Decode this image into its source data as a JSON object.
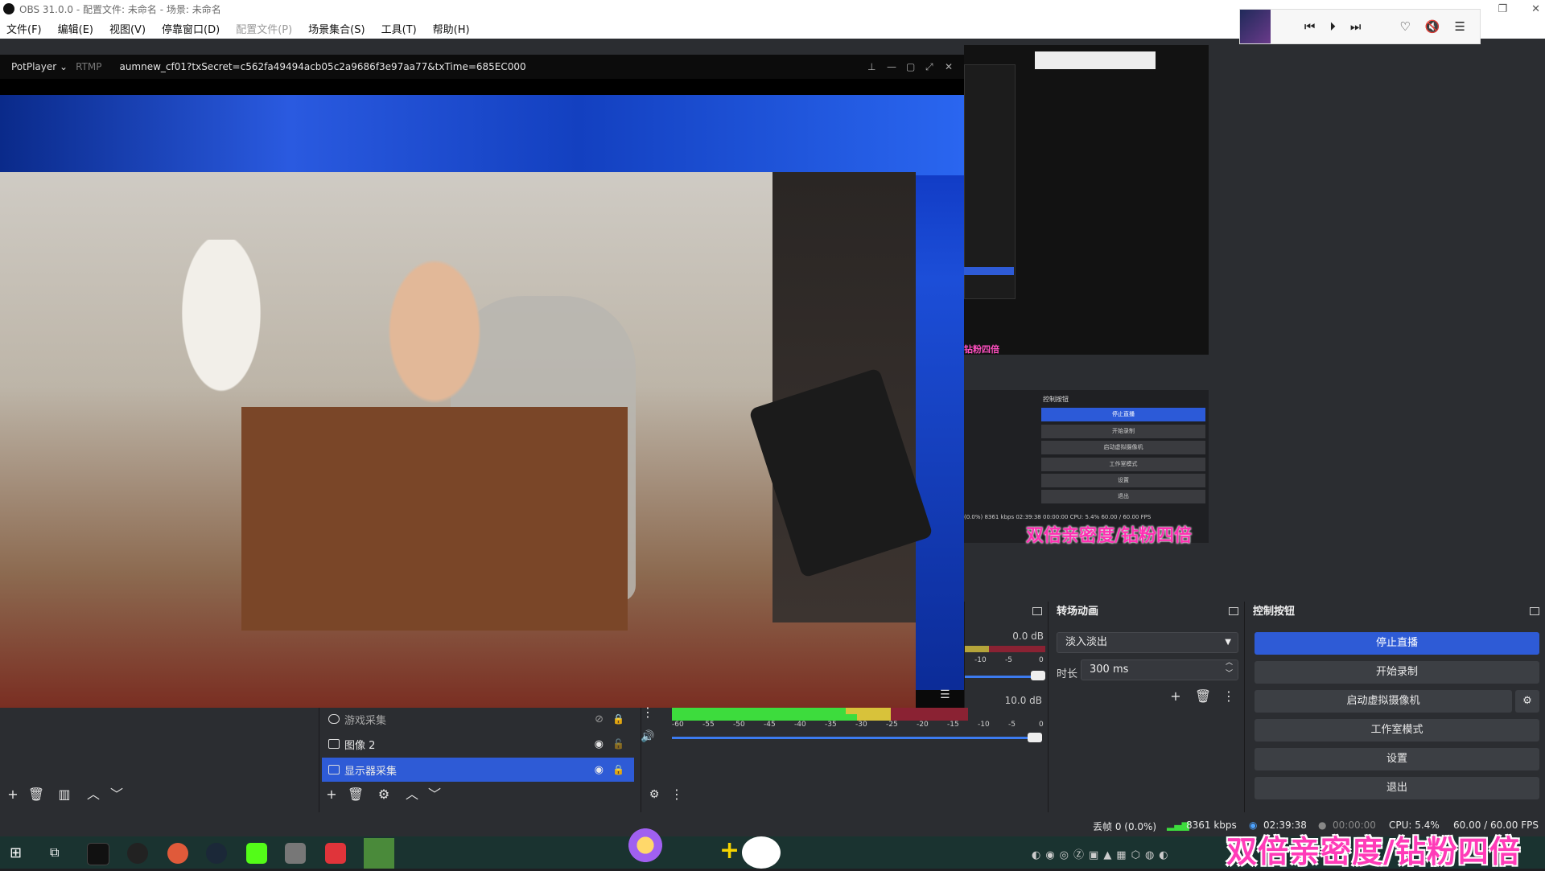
{
  "window": {
    "title": "OBS 31.0.0 - 配置文件: 未命名 - 场景: 未命名",
    "min": "—",
    "max": "❐",
    "close": "✕"
  },
  "menu": [
    "文件(F)",
    "编辑(E)",
    "视图(V)",
    "停靠窗口(D)",
    "配置文件(P)",
    "场景集合(S)",
    "工具(T)",
    "帮助(H)"
  ],
  "potplayer": {
    "app": "PotPlayer",
    "protocol": "RTMP",
    "url": "aumnew_cf01?txSecret=c562fa49494acb05c2a9686f3e97aa77&txTime=685EC000"
  },
  "audio": {
    "db_top": "0.0 dB",
    "db_bottom": "10.0 dB",
    "scale": [
      "-60",
      "-55",
      "-50",
      "-45",
      "-40",
      "-35",
      "-30",
      "-25",
      "-20",
      "-15",
      "-10",
      "-5",
      "0"
    ],
    "scale_short": [
      "-10",
      "-5",
      "0"
    ]
  },
  "sources": [
    {
      "label": "游戏采集",
      "visible": false
    },
    {
      "label": "图像 2",
      "visible": true
    },
    {
      "label": "显示器采集",
      "visible": true,
      "selected": true
    }
  ],
  "transitions": {
    "title": "转场动画",
    "selected": "淡入淡出",
    "duration_label": "时长",
    "duration": "300 ms"
  },
  "controls": {
    "title": "控制按钮",
    "stop_stream": "停止直播",
    "start_record": "开始录制",
    "start_virtual_cam": "启动虚拟摄像机",
    "studio_mode": "工作室模式",
    "settings": "设置",
    "exit": "退出"
  },
  "status": {
    "dropped": "丢帧 0 (0.0%)",
    "bitrate": "8361 kbps",
    "stream_time": "02:39:38",
    "record_time": "00:00:00",
    "cpu": "CPU: 5.4%",
    "fps": "60.00 / 60.00 FPS"
  },
  "promo_text": "双倍亲密度/钻粉四倍",
  "nested_preview": {
    "stop_stream": "停止直播",
    "start_record": "开始录制",
    "start_virtual_cam": "启动虚拟摄像机",
    "studio_mode": "工作室模式",
    "settings": "设置",
    "exit": "退出",
    "title": "控制按钮",
    "status": "(0.0%)   8361 kbps   02:39:38   00:00:00   CPU: 5.4%   60.00 / 60.00 FPS",
    "promo": "双倍亲密度/钻粉四倍",
    "small_promo": "钻粉四倍"
  },
  "colors": {
    "accent": "#2e5bd6",
    "panel": "#2b2d31",
    "promo": "#ff3bb8"
  }
}
